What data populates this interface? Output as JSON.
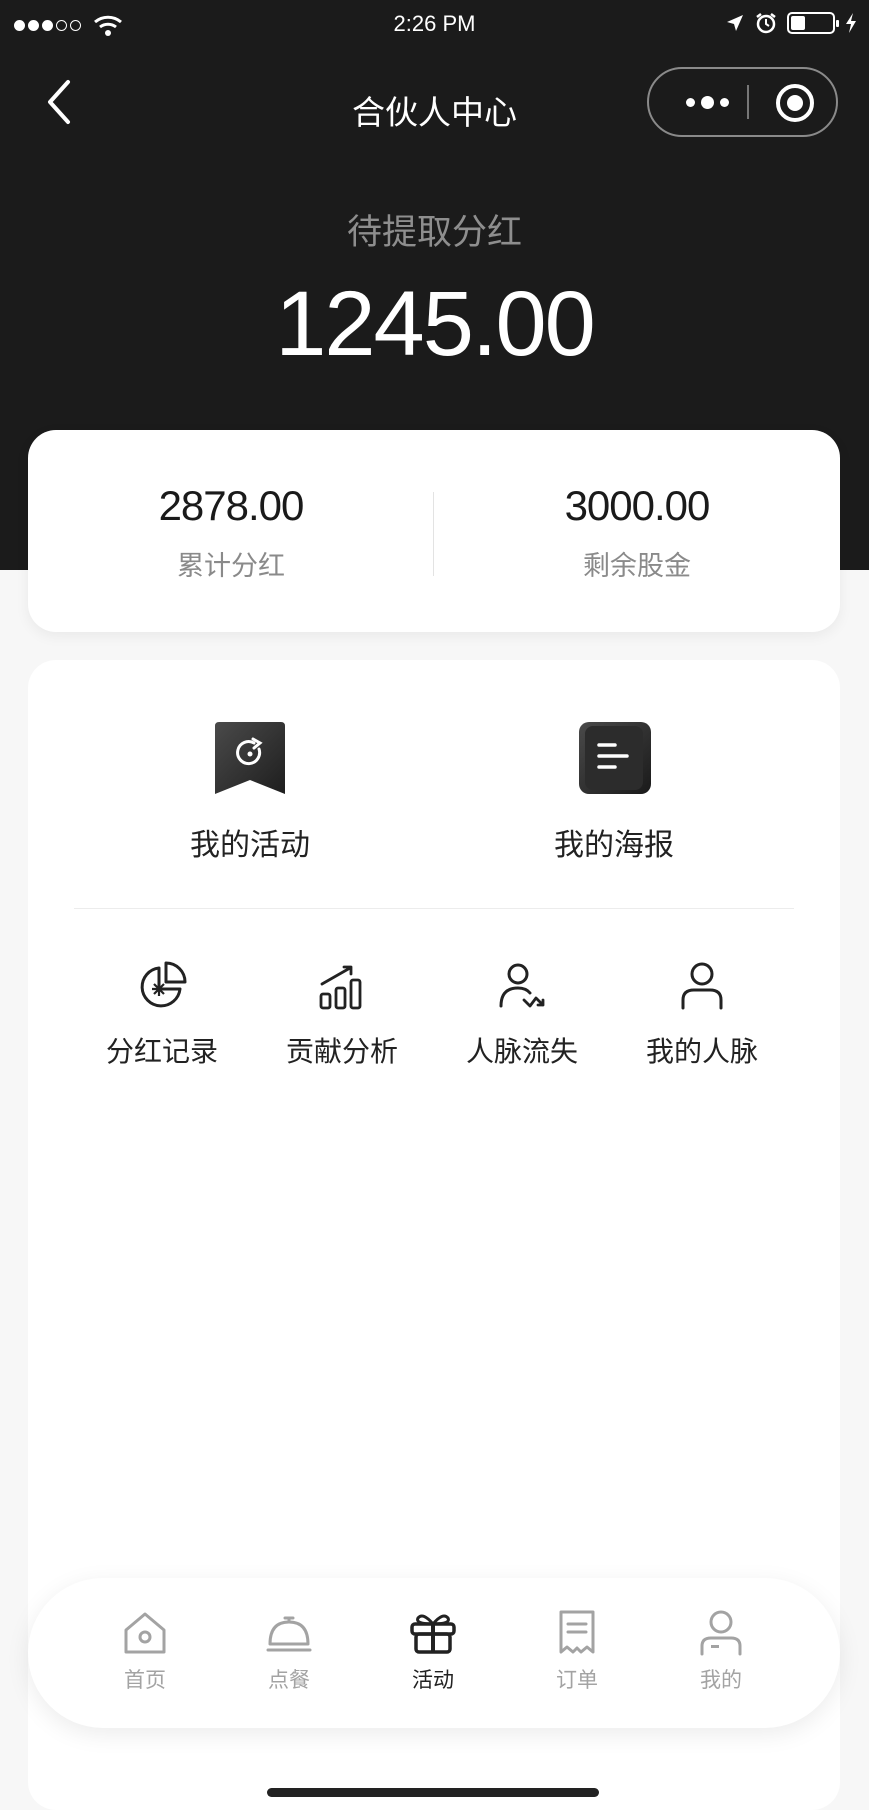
{
  "status_bar": {
    "time": "2:26 PM",
    "battery_level": 0.35
  },
  "nav": {
    "title": "合伙人中心"
  },
  "summary": {
    "pending_label": "待提取分红",
    "pending_amount": "1245.00",
    "stats": [
      {
        "value": "2878.00",
        "label": "累计分红"
      },
      {
        "value": "3000.00",
        "label": "剩余股金"
      }
    ]
  },
  "menu": {
    "primary": [
      {
        "label": "我的活动",
        "icon": "activity-icon"
      },
      {
        "label": "我的海报",
        "icon": "poster-icon"
      }
    ],
    "secondary": [
      {
        "label": "分红记录",
        "icon": "pie-chart-icon"
      },
      {
        "label": "贡献分析",
        "icon": "bar-chart-icon"
      },
      {
        "label": "人脉流失",
        "icon": "user-decline-icon"
      },
      {
        "label": "我的人脉",
        "icon": "user-icon"
      }
    ]
  },
  "tabbar": {
    "tabs": [
      {
        "label": "首页",
        "icon": "home-icon"
      },
      {
        "label": "点餐",
        "icon": "cloche-icon"
      },
      {
        "label": "活动",
        "icon": "gift-icon",
        "active": true
      },
      {
        "label": "订单",
        "icon": "receipt-icon"
      },
      {
        "label": "我的",
        "icon": "profile-icon"
      }
    ]
  },
  "colors": {
    "header_bg": "#1b1b1b",
    "page_bg": "#f7f7f7",
    "muted_text": "#8a8a8a",
    "inactive_tab": "#a3a3a3"
  }
}
